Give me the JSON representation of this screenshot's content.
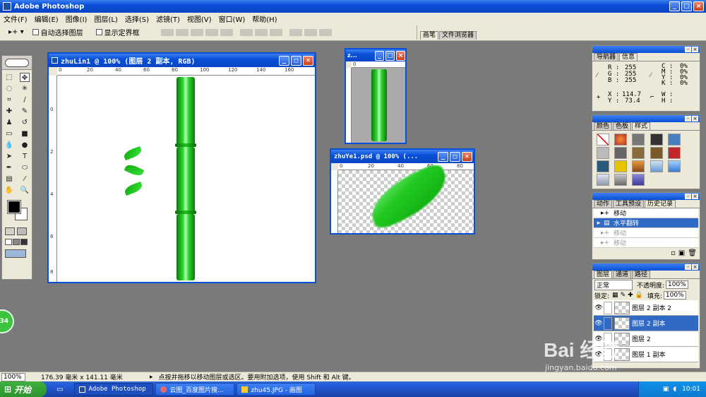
{
  "app": {
    "title": "Adobe Photoshop",
    "window_buttons": [
      "_",
      "□",
      "×"
    ]
  },
  "menu": [
    "文件(F)",
    "编辑(E)",
    "图像(I)",
    "图层(L)",
    "选择(S)",
    "滤镜(T)",
    "视图(V)",
    "窗口(W)",
    "帮助(H)"
  ],
  "options": {
    "move_tool": "▸+ ▾",
    "auto_select": "自动选择图层",
    "show_bounds": "显示定界框",
    "brush_tab": "画笔",
    "file_browser_tab": "文件浏览器"
  },
  "doc1": {
    "title": "zhuLin1 @ 100% (图层 2 副本, RGB)",
    "ruler_labels": [
      "0",
      "20",
      "40",
      "60",
      "80",
      "100",
      "120",
      "140",
      "160"
    ],
    "vruler_labels": [
      "0",
      "2",
      "4",
      "6",
      "8"
    ]
  },
  "doc2": {
    "title": "z...",
    "ruler_labels": [
      "0"
    ]
  },
  "doc3": {
    "title": "zhuYe1.psd @ 100% (...",
    "ruler_labels": [
      "0",
      "20",
      "40",
      "60",
      "80"
    ]
  },
  "navigator": {
    "tabs": [
      "导航器",
      "信息"
    ],
    "r_label": "R :",
    "g_label": "G :",
    "b_label": "B :",
    "r": "255",
    "g": "255",
    "b": "255",
    "c_label": "C :",
    "m_label": "M :",
    "y_label": "Y :",
    "k_label": "K :",
    "c": "0%",
    "m": "0%",
    "y": "0%",
    "k": "0%",
    "x_label": "X :",
    "y2_label": "Y :",
    "x": "114.7",
    "y2": "73.4",
    "w_label": "W :",
    "h_label": "H :"
  },
  "swatches": {
    "tabs": [
      "颜色",
      "色板",
      "样式"
    ]
  },
  "history": {
    "tabs": [
      "动作",
      "工具预设",
      "历史记录"
    ],
    "items": [
      {
        "label": "移动",
        "active": false,
        "dim": false
      },
      {
        "label": "水平翻转",
        "active": true,
        "dim": false
      },
      {
        "label": "移动",
        "active": false,
        "dim": true
      },
      {
        "label": "移动",
        "active": false,
        "dim": true
      }
    ]
  },
  "layers": {
    "tabs": [
      "图层",
      "通道",
      "路径"
    ],
    "blend_mode": "正常",
    "opacity_label": "不透明度:",
    "opacity": "100%",
    "lock_label": "锁定:",
    "fill_label": "填充:",
    "fill": "100%",
    "items": [
      {
        "label": "图层 2 副本 2",
        "active": false
      },
      {
        "label": "图层 2 副本",
        "active": true
      },
      {
        "label": "图层 2",
        "active": false
      },
      {
        "label": "图层 1 副本",
        "active": false
      }
    ]
  },
  "status": {
    "zoom": "100%",
    "size": "176.39 毫米 x 141.11 毫米",
    "hint": "点按并拖移以移动图层或选区。要用附加选项，使用 Shift 和 Alt 键。"
  },
  "taskbar": {
    "start": "开始",
    "tasks": [
      "Adobe Photoshop",
      "云图_百度图片搜...",
      "zhu45.JPG - 画图"
    ],
    "clock": "10:01"
  },
  "badge": "34",
  "watermark": {
    "logo": "Bai 经验",
    "url": "jingyan.baidu.com"
  },
  "colors": {
    "title_blue": "#0a4fd8",
    "canvas_bg": "#7a7a7a",
    "panel_bg": "#ece9d8",
    "bamboo": "#22c922",
    "selection": "#316ac5"
  }
}
